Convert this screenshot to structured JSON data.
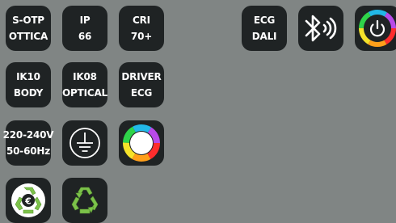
{
  "badges": [
    {
      "name": "s-otp-ottica",
      "lines": [
        "S-OTP",
        "OTTICA"
      ]
    },
    {
      "name": "ip-66",
      "lines": [
        "IP",
        "66"
      ]
    },
    {
      "name": "cri-70",
      "lines": [
        "CRI",
        "70+"
      ]
    },
    {
      "name": "ecg-dali",
      "lines": [
        "ECG",
        "DALI"
      ]
    },
    {
      "name": "ik10-body",
      "lines": [
        "IK10",
        "BODY"
      ]
    },
    {
      "name": "ik08-optical",
      "lines": [
        "IK08",
        "OPTICAL"
      ]
    },
    {
      "name": "driver-ecg",
      "lines": [
        "DRIVER",
        "ECG"
      ]
    },
    {
      "name": "voltage-frequency",
      "lines": [
        "220-240V",
        "50-60Hz"
      ]
    }
  ],
  "icons": {
    "bluetooth": "bluetooth-icon",
    "rgb_power": "rgb-power-icon",
    "ground": "ground-icon",
    "color_wheel": "color-wheel-icon",
    "recycle_euro": "recycle-euro-icon",
    "recycle": "recycle-icon"
  },
  "colors": {
    "background": "#808584",
    "tile": "#1f2324",
    "text": "#ffffff",
    "recycle_green": "#7cc24a"
  }
}
